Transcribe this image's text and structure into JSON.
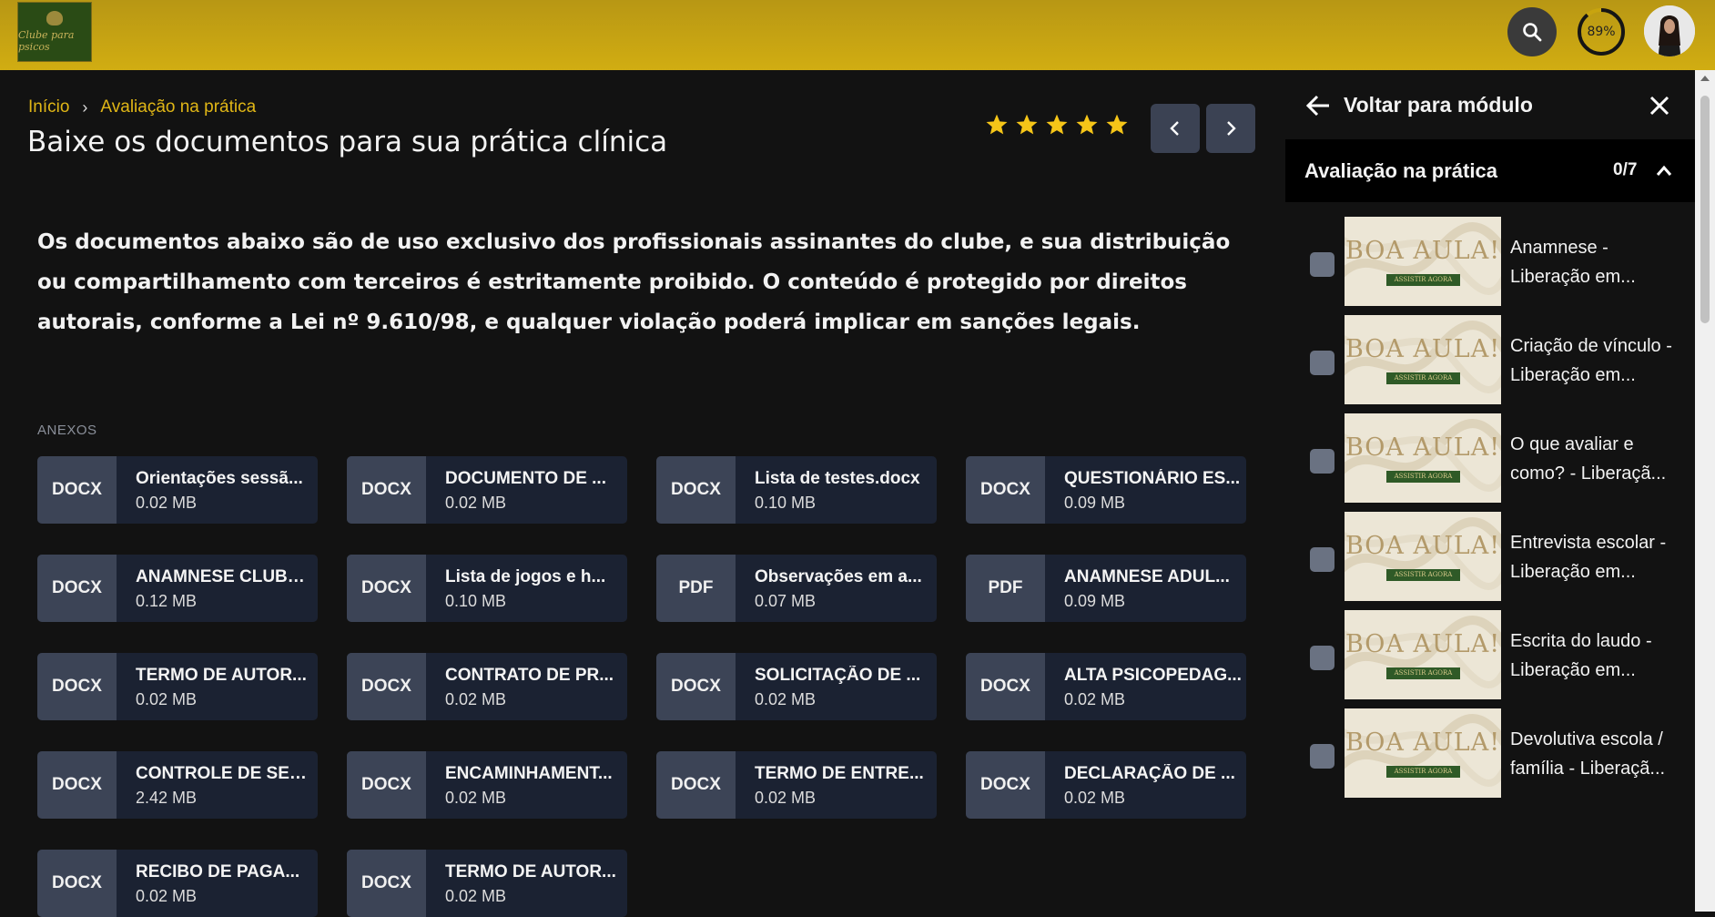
{
  "header": {
    "logo_text": "Clube para psicos",
    "progress": "89%",
    "progress_fraction": 0.89,
    "icons": {
      "search": "search-icon",
      "avatar": "user-avatar"
    }
  },
  "breadcrumb": {
    "home": "Início",
    "current": "Avaliação na prática"
  },
  "page": {
    "title": "Baixe os documentos para sua prática clínica",
    "rating": 5,
    "description": "Os documentos abaixo são de uso exclusivo dos profissionais assinantes do clube, e sua distribuição ou compartilhamento com terceiros é estritamente proibido. O conteúdo é protegido por direitos autorais, conforme a Lei nº 9.610/98, e qualquer violação poderá implicar em sanções legais.",
    "attachments_label": "ANEXOS"
  },
  "attachments": [
    {
      "type": "DOCX",
      "name": "Orientações sessã...",
      "size": "0.02 MB"
    },
    {
      "type": "DOCX",
      "name": "DOCUMENTO DE ...",
      "size": "0.02 MB"
    },
    {
      "type": "DOCX",
      "name": "Lista de testes.docx",
      "size": "0.10 MB"
    },
    {
      "type": "DOCX",
      "name": "QUESTIONÁRIO ES...",
      "size": "0.09 MB"
    },
    {
      "type": "DOCX",
      "name": "ANAMNESE CLUBE...",
      "size": "0.12 MB"
    },
    {
      "type": "DOCX",
      "name": "Lista de jogos e h...",
      "size": "0.10 MB"
    },
    {
      "type": "PDF",
      "name": "Observações em a...",
      "size": "0.07 MB"
    },
    {
      "type": "PDF",
      "name": "ANAMNESE ADUL...",
      "size": "0.09 MB"
    },
    {
      "type": "DOCX",
      "name": "TERMO DE AUTOR...",
      "size": "0.02 MB"
    },
    {
      "type": "DOCX",
      "name": "CONTRATO DE PR...",
      "size": "0.02 MB"
    },
    {
      "type": "DOCX",
      "name": "SOLICITAÇÃO DE ...",
      "size": "0.02 MB"
    },
    {
      "type": "DOCX",
      "name": "ALTA PSICOPEDAG...",
      "size": "0.02 MB"
    },
    {
      "type": "DOCX",
      "name": "CONTROLE DE SES...",
      "size": "2.42 MB"
    },
    {
      "type": "DOCX",
      "name": "ENCAMINHAMENT...",
      "size": "0.02 MB"
    },
    {
      "type": "DOCX",
      "name": "TERMO DE ENTRE...",
      "size": "0.02 MB"
    },
    {
      "type": "DOCX",
      "name": "DECLARAÇÃO DE ...",
      "size": "0.02 MB"
    },
    {
      "type": "DOCX",
      "name": "RECIBO DE PAGA...",
      "size": "0.02 MB"
    },
    {
      "type": "DOCX",
      "name": "TERMO DE AUTOR...",
      "size": "0.02 MB"
    }
  ],
  "sidebar": {
    "back_label": "Voltar para módulo",
    "module_title": "Avaliação na prática",
    "module_count": "0/7",
    "lessons": [
      {
        "title": "Anamnese - Liberação em...",
        "thumb_title": "BOA AULA!",
        "thumb_button": "ASSISTIR AGORA",
        "completed": false
      },
      {
        "title": "Criação de vínculo - Liberação em...",
        "thumb_title": "BOA AULA!",
        "thumb_button": "ASSISTIR AGORA",
        "completed": false
      },
      {
        "title": "O que avaliar e como? - Liberaçã...",
        "thumb_title": "BOA AULA!",
        "thumb_button": "ASSISTIR AGORA",
        "completed": false
      },
      {
        "title": "Entrevista escolar - Liberação em...",
        "thumb_title": "BOA AULA!",
        "thumb_button": "ASSISTIR AGORA",
        "completed": false
      },
      {
        "title": "Escrita do laudo - Liberação em...",
        "thumb_title": "BOA AULA!",
        "thumb_button": "ASSISTIR AGORA",
        "completed": false
      },
      {
        "title": "Devolutiva escola / família - Liberaçã...",
        "thumb_title": "BOA AULA!",
        "thumb_button": "ASSISTIR AGORA",
        "completed": false
      }
    ]
  },
  "colors": {
    "accent": "#e0b616",
    "topbar": "#cfa912",
    "card": "#1b2232",
    "card_type": "#3c4456"
  }
}
